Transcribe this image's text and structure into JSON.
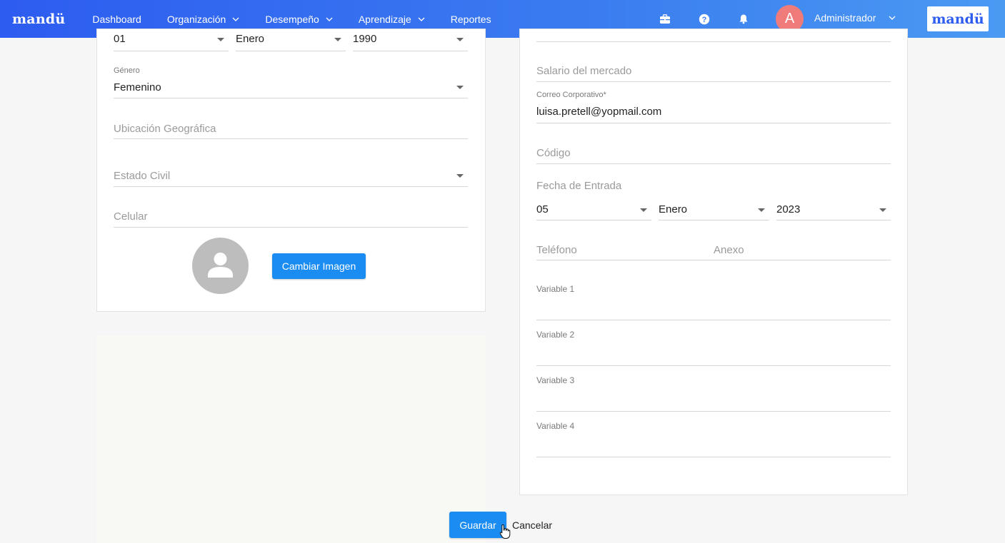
{
  "nav": {
    "brand": "mandü",
    "items": [
      {
        "label": "Dashboard"
      },
      {
        "label": "Organización"
      },
      {
        "label": "Desempeño"
      },
      {
        "label": "Aprendizaje"
      },
      {
        "label": "Reportes"
      }
    ],
    "icons": [
      "briefcase-icon",
      "help-icon",
      "bell-icon"
    ],
    "avatar_letter": "A",
    "user_label": "Administrador",
    "logo_text": "mandü"
  },
  "left_form": {
    "birth_day": "01",
    "birth_month": "Enero",
    "birth_year": "1990",
    "gender_label": "Género",
    "gender_value": "Femenino",
    "location_placeholder": "Ubicación Geográfica",
    "marital_placeholder": "Estado Civil",
    "cell_placeholder": "Celular",
    "change_image_label": "Cambiar Imagen"
  },
  "right_form": {
    "market_salary_placeholder": "Salario del mercado",
    "email_label": "Correo Corporativo*",
    "email_value": "luisa.pretell@yopmail.com",
    "code_placeholder": "Código",
    "entry_date_label": "Fecha de Entrada",
    "entry_day": "05",
    "entry_month": "Enero",
    "entry_year": "2023",
    "phone_placeholder": "Teléfono",
    "extension_placeholder": "Anexo",
    "variable1_label": "Variable 1",
    "variable2_label": "Variable 2",
    "variable3_label": "Variable 3",
    "variable4_label": "Variable 4"
  },
  "actions": {
    "save_label": "Guardar",
    "cancel_label": "Cancelar"
  },
  "colors": {
    "nav_start": "#2d5cf0",
    "nav_end": "#4a9af2",
    "primary_button": "#1a8cf2",
    "avatar_bg": "#f07b7b"
  }
}
